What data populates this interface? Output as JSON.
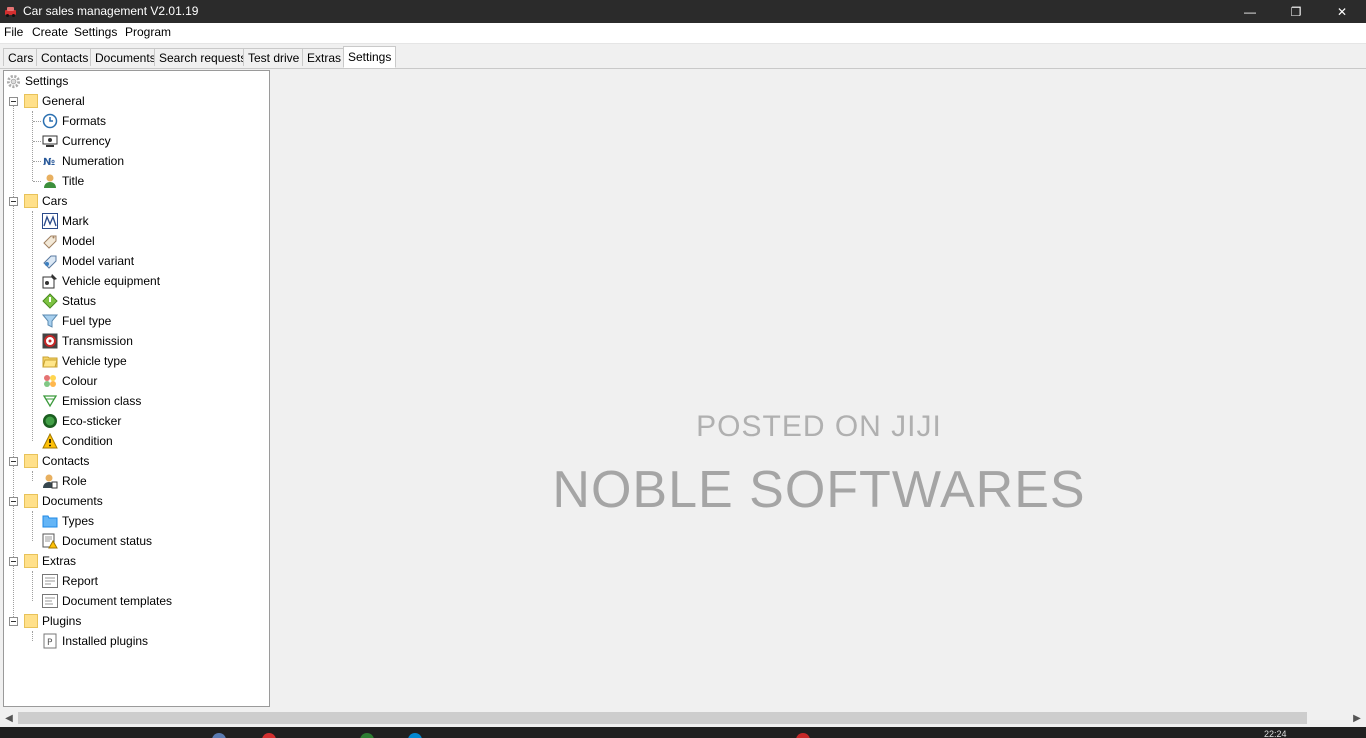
{
  "window": {
    "title": "Car sales management V2.01.19",
    "controls": {
      "minimize": "—",
      "maximize": "❐",
      "close": "✕"
    }
  },
  "menu": {
    "items": [
      "File",
      "Create",
      "Settings",
      "Program"
    ]
  },
  "tabs": {
    "items": [
      "Cars",
      "Contacts",
      "Documents",
      "Search requests",
      "Test drive",
      "Extras",
      "Settings"
    ],
    "active": "Settings"
  },
  "tree": {
    "root": "Settings",
    "groups": {
      "general": {
        "label": "General",
        "items": [
          "Formats",
          "Currency",
          "Numeration",
          "Title"
        ]
      },
      "cars": {
        "label": "Cars",
        "items": [
          "Mark",
          "Model",
          "Model variant",
          "Vehicle equipment",
          "Status",
          "Fuel type",
          "Transmission",
          "Vehicle type",
          "Colour",
          "Emission class",
          "Eco-sticker",
          "Condition"
        ]
      },
      "contacts": {
        "label": "Contacts",
        "items": [
          "Role"
        ]
      },
      "documents": {
        "label": "Documents",
        "items": [
          "Types",
          "Document status"
        ]
      },
      "extras": {
        "label": "Extras",
        "items": [
          "Report",
          "Document templates"
        ]
      },
      "plugins": {
        "label": "Plugins",
        "items": [
          "Installed plugins"
        ]
      }
    }
  },
  "watermark": {
    "line1": "POSTED ON JIJI",
    "line2": "NOBLE SOFTWARES"
  },
  "scrollbar": {
    "left_arrow": "◀",
    "right_arrow": "▶"
  },
  "taskbar": {
    "clock": "22:24"
  },
  "colors": {
    "titlebar": "#2b2b2b",
    "folder": "#ffe08a",
    "watermark": "#a5a5a5"
  }
}
